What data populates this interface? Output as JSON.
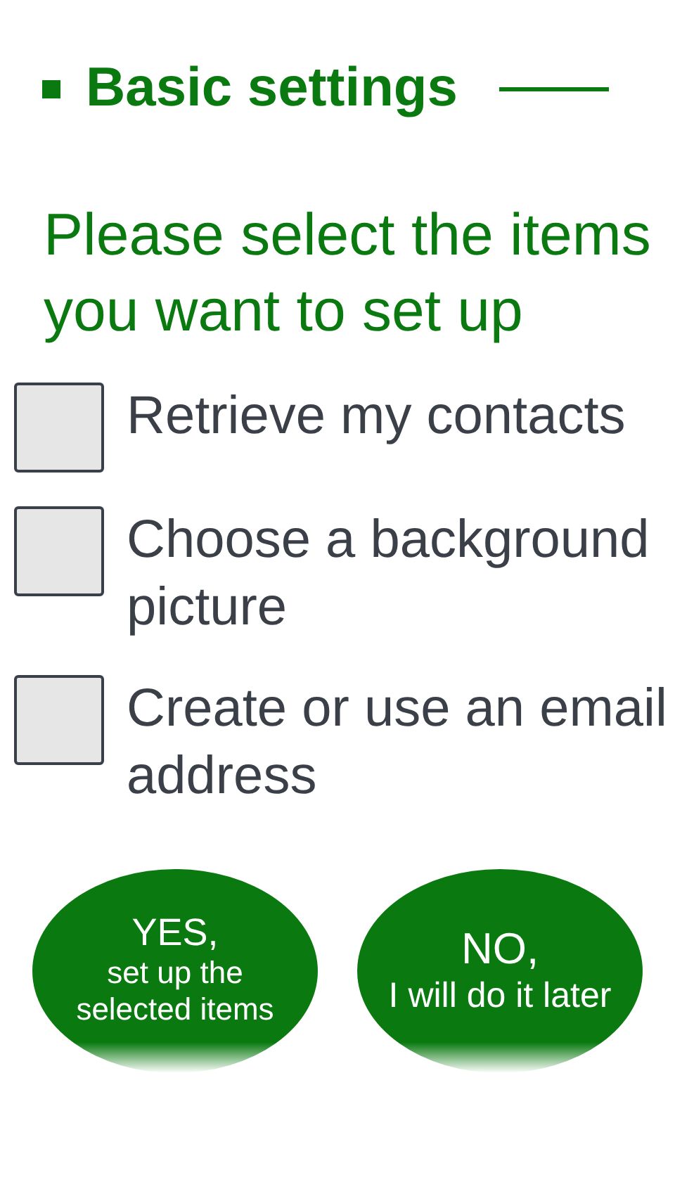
{
  "header": {
    "title": "Basic settings"
  },
  "prompt": "Please select the items you want to set up",
  "items": [
    {
      "label": "Retrieve my contacts",
      "checked": false
    },
    {
      "label": "Choose a background picture",
      "checked": false
    },
    {
      "label": "Create or use an email address",
      "checked": false
    }
  ],
  "buttons": [
    {
      "kind": "yes",
      "heading": "YES,",
      "text": "set up the selected items"
    },
    {
      "kind": "no",
      "heading": "NO,",
      "text": "I will do it later"
    }
  ]
}
